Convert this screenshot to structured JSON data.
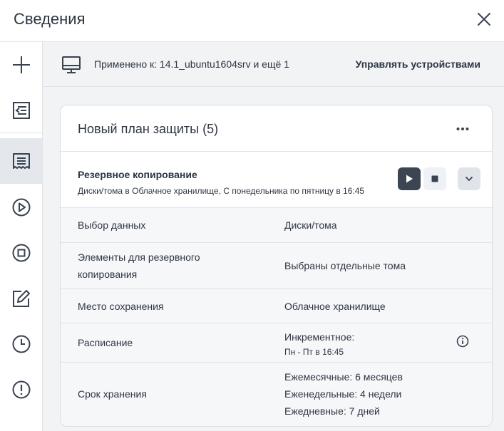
{
  "header": {
    "title": "Сведения"
  },
  "sidebar": {
    "items": [
      {
        "icon": "plus-icon"
      },
      {
        "icon": "apply-plan-icon"
      },
      {
        "icon": "plan-details-icon",
        "active": true
      },
      {
        "icon": "run-icon"
      },
      {
        "icon": "stop-icon"
      },
      {
        "icon": "edit-icon"
      },
      {
        "icon": "history-icon"
      },
      {
        "icon": "alert-icon"
      }
    ]
  },
  "applied": {
    "text": "Применено к: 14.1_ubuntu1604srv и ещё 1",
    "manage_label": "Управлять устройствами"
  },
  "plan": {
    "title": "Новый план защиты (5)",
    "section": {
      "title": "Резервное копирование",
      "subtitle": "Диски/тома в Облачное хранилище, С понедельника по пятницу в 16:45"
    },
    "rows": {
      "data_selection": {
        "label": "Выбор данных",
        "value": "Диски/тома"
      },
      "items": {
        "label_line1": "Элементы для резервного",
        "label_line2": "копирования",
        "value": "Выбраны отдельные тома"
      },
      "destination": {
        "label": "Место сохранения",
        "value": "Облачное хранилище"
      },
      "schedule": {
        "label": "Расписание",
        "value": "Инкрементное:",
        "value_sub": "Пн - Пт в 16:45"
      },
      "retention": {
        "label": "Срок хранения",
        "monthly": "Ежемесячные: 6 месяцев",
        "weekly": "Еженедельные: 4 недели",
        "daily": "Ежедневные: 7 дней"
      }
    }
  },
  "colors": {
    "accent_dark": "#3c4652",
    "text": "#2d3642",
    "border": "#dfe3e8",
    "background": "#f1f3f5"
  }
}
